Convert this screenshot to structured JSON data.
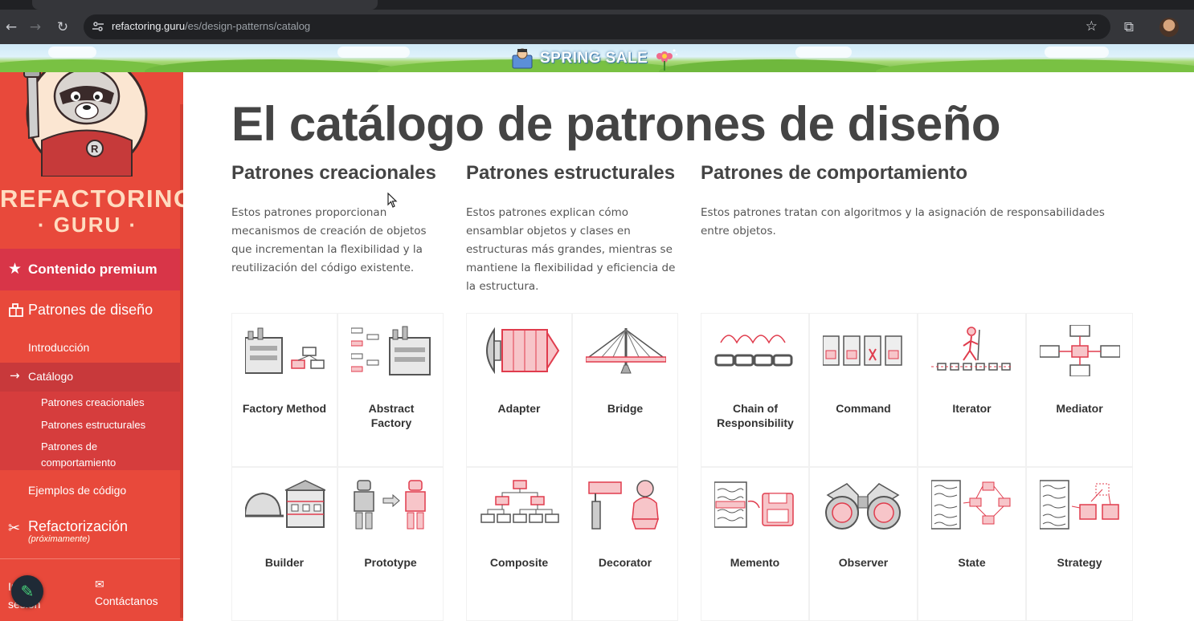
{
  "browser": {
    "url_host": "refactoring.guru",
    "url_path": "/es/design-patterns/catalog"
  },
  "banner": {
    "text": "SPRING SALE"
  },
  "sidebar": {
    "brand_line1": "REFACTORING",
    "brand_line2": "· GURU ·",
    "premium": "Contenido premium",
    "patterns": "Patrones de diseño",
    "intro": "Introducción",
    "catalog": "Catálogo",
    "sub_creational": "Patrones creacionales",
    "sub_structural": "Patrones estructurales",
    "sub_behavioral": "Patrones de comportamiento",
    "examples": "Ejemplos de código",
    "refactoring": "Refactorización",
    "refactoring_note": "(próximamente)",
    "login": "Iniciar sesión",
    "contact": "Contáctanos"
  },
  "main": {
    "title": "El catálogo de patrones de diseño",
    "categories": [
      {
        "title": "Patrones creacionales",
        "desc": "Estos patrones proporcionan mecanismos de creación de objetos que incrementan la flexibilidad y la reutilización del código existente."
      },
      {
        "title": "Patrones estructurales",
        "desc": "Estos patrones explican cómo ensamblar objetos y clases en estructuras más grandes, mientras se mantiene la flexibilidad y eficiencia de la estructura."
      },
      {
        "title": "Patrones de comportamiento",
        "desc": "Estos patrones tratan con algoritmos y la asignación de responsabilidades entre objetos."
      }
    ],
    "patterns": {
      "factory_method": "Factory Method",
      "abstract_factory": "Abstract Factory",
      "builder": "Builder",
      "prototype": "Prototype",
      "adapter": "Adapter",
      "bridge": "Bridge",
      "composite": "Composite",
      "decorator": "Decorator",
      "chain": "Chain of Responsibility",
      "command": "Command",
      "iterator": "Iterator",
      "mediator": "Mediator",
      "memento": "Memento",
      "observer": "Observer",
      "state": "State",
      "strategy": "Strategy"
    }
  },
  "colors": {
    "sidebar": "#e8493b",
    "accent": "#d8344a",
    "icon_red": "#e03c4d"
  }
}
